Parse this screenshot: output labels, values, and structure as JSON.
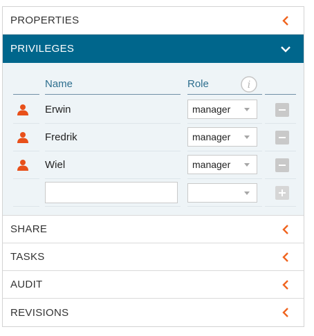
{
  "sections": {
    "properties": "PROPERTIES",
    "privileges": "PRIVILEGES",
    "share": "SHARE",
    "tasks": "TASKS",
    "audit": "AUDIT",
    "revisions": "REVISIONS"
  },
  "privileges_table": {
    "col_name": "Name",
    "col_role": "Role",
    "rows": [
      {
        "name": "Erwin",
        "role": "manager"
      },
      {
        "name": "Fredrik",
        "role": "manager"
      },
      {
        "name": "Wiel",
        "role": "manager"
      }
    ],
    "new_row": {
      "name_value": "",
      "role_value": ""
    }
  },
  "icons": {
    "collapsed": "chevron-left-icon",
    "expanded": "chevron-down-icon",
    "user": "user-icon",
    "info": "info-icon",
    "remove": "minus-icon",
    "add": "plus-icon"
  },
  "colors": {
    "active_header": "#00668c",
    "chevron": "#f0641e",
    "user_icon": "#e8501a",
    "column_header_text": "#2d6e8e",
    "panel_body": "#eef4f7"
  }
}
